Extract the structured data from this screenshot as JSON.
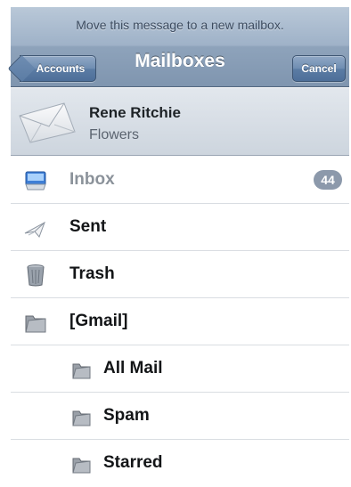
{
  "header": {
    "prompt": "Move this message to a new mailbox.",
    "title": "Mailboxes",
    "back_label": "Accounts",
    "cancel_label": "Cancel"
  },
  "message": {
    "from": "Rene Ritchie",
    "subject": "Flowers"
  },
  "mailboxes": [
    {
      "name": "Inbox",
      "icon": "inbox-icon",
      "badge": "44",
      "disabled": true
    },
    {
      "name": "Sent",
      "icon": "sent-icon"
    },
    {
      "name": "Trash",
      "icon": "trash-icon"
    },
    {
      "name": "[Gmail]",
      "icon": "folder-icon"
    },
    {
      "name": "All Mail",
      "icon": "folder-icon"
    },
    {
      "name": "Spam",
      "icon": "folder-icon"
    },
    {
      "name": "Starred",
      "icon": "folder-icon"
    }
  ],
  "colors": {
    "navbar": "#9fb2c8",
    "button": "#5b7ca4",
    "badge": "#8c99ab",
    "disabled_text": "#8b929a"
  }
}
